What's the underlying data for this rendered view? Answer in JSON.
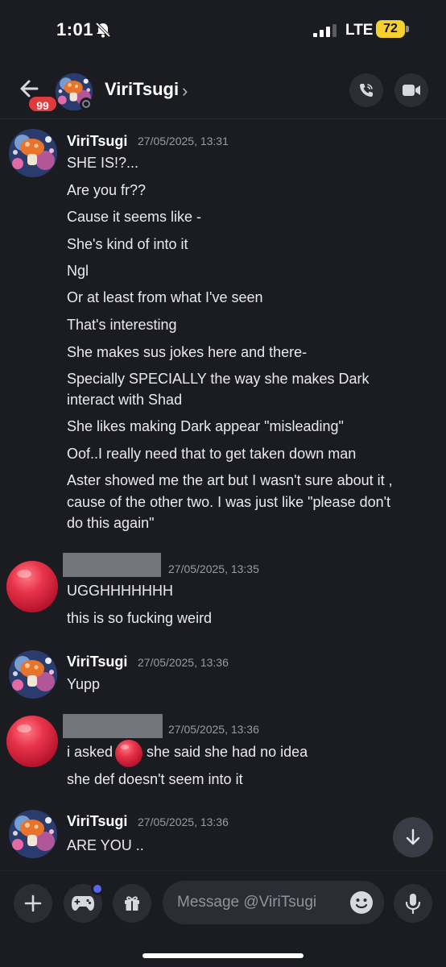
{
  "status_bar": {
    "time": "1:01",
    "network": "LTE",
    "battery": "72"
  },
  "header": {
    "unread_badge": "99",
    "contact_name": "ViriTsugi",
    "chevron": "›"
  },
  "messages": [
    {
      "author": "ViriTsugi",
      "timestamp": "27/05/2025, 13:31",
      "lines": [
        "SHE IS!?...",
        "Are you fr??",
        "Cause it seems like -",
        "She's kind of into it",
        "Ngl",
        "Or at least from what I've seen",
        "That's interesting",
        "She makes sus jokes here and there-",
        "Specially SPECIALLY the way she makes Dark",
        "interact with Shad",
        "She likes making Dark appear \"misleading\"",
        "Oof..I really need that to get taken down man",
        "Aster showed me the art but I wasn't sure about it ,",
        "cause of the other two. I was just like \"please don't",
        "do this again\""
      ]
    },
    {
      "author": "",
      "timestamp": "27/05/2025, 13:35",
      "lines": [
        "UGGHHHHHHH",
        "this is so fucking weird"
      ]
    },
    {
      "author": "ViriTsugi",
      "timestamp": "27/05/2025, 13:36",
      "lines": [
        "Yupp"
      ]
    },
    {
      "author": "",
      "timestamp": "27/05/2025, 13:36",
      "lines": [
        "i asked",
        "she said she had no idea",
        "she def doesn't seem into it"
      ]
    },
    {
      "author": "ViriTsugi",
      "timestamp": "27/05/2025, 13:36",
      "lines": [
        "ARE YOU .."
      ]
    }
  ],
  "composer": {
    "placeholder": "Message @ViriTsugi"
  },
  "colors": {
    "background": "#1b1c22",
    "accent": "#5865f2",
    "badge": "#e03a3e",
    "battery": "#f5d130",
    "red_avatar": "#e8344a"
  },
  "icons": [
    "bell-slash-icon",
    "signal-icon",
    "back-arrow-icon",
    "phone-icon",
    "video-icon",
    "plus-icon",
    "gamepad-icon",
    "gift-icon",
    "emoji-icon",
    "microphone-icon",
    "arrow-down-icon"
  ]
}
